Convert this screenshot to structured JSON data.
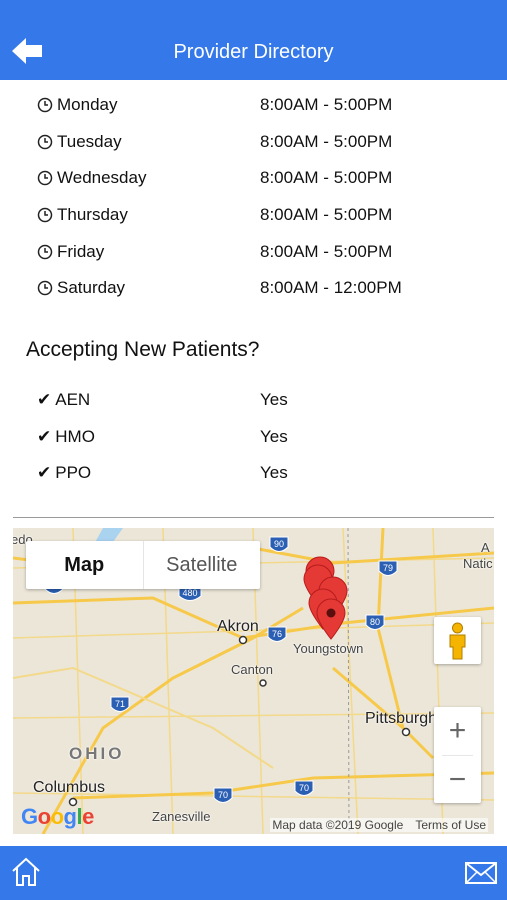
{
  "header": {
    "title": "Provider Directory",
    "back_icon": "arrow-left-icon"
  },
  "hours": [
    {
      "day": "Monday",
      "time": "8:00AM - 5:00PM"
    },
    {
      "day": "Tuesday",
      "time": "8:00AM - 5:00PM"
    },
    {
      "day": "Wednesday",
      "time": "8:00AM - 5:00PM"
    },
    {
      "day": "Thursday",
      "time": "8:00AM - 5:00PM"
    },
    {
      "day": "Friday",
      "time": "8:00AM - 5:00PM"
    },
    {
      "day": "Saturday",
      "time": "8:00AM - 12:00PM"
    }
  ],
  "accepting": {
    "title": "Accepting New Patients?",
    "plans": [
      {
        "name": "AEN",
        "value": "Yes"
      },
      {
        "name": "HMO",
        "value": "Yes"
      },
      {
        "name": "PPO",
        "value": "Yes"
      }
    ]
  },
  "map": {
    "type_map": "Map",
    "type_satellite": "Satellite",
    "labels": {
      "akron": "Akron",
      "canton": "Canton",
      "youngstown": "Youngstown",
      "pittsburgh": "Pittsburgh",
      "ohio": "OHIO",
      "columbus": "Columbus",
      "zanesville": "Zanesville",
      "natick": "Natic",
      "edge_a": "A",
      "edge_left": "edo"
    },
    "highways": [
      "90",
      "79",
      "480",
      "76",
      "80",
      "71",
      "70",
      "70",
      "90"
    ],
    "attribution": "Map data ©2019 Google",
    "terms": "Terms of Use",
    "logo": "Google",
    "zoom_in": "+",
    "zoom_out": "−"
  },
  "footer": {
    "home_icon": "home-icon",
    "mail_icon": "mail-icon"
  },
  "colors": {
    "accent": "#3478ea",
    "pin": "#e53935",
    "road": "#f7d36b"
  }
}
